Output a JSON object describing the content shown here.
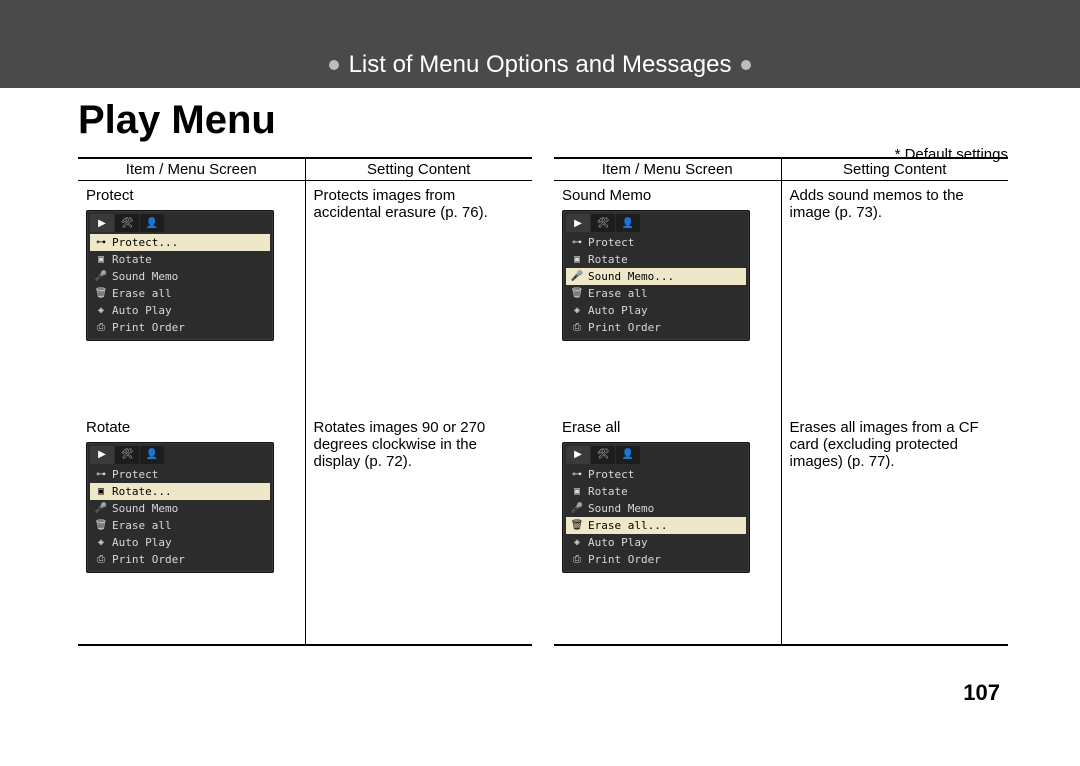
{
  "chapter_title": "List of Menu Options and Messages",
  "page_heading": "Play Menu",
  "default_note": "* Default settings",
  "page_number": "107",
  "lcd_tabs": [
    "▶",
    "🛠",
    "👤"
  ],
  "lcd_items_base": [
    {
      "icon": "⊶",
      "label": "Protect"
    },
    {
      "icon": "▣",
      "label": "Rotate"
    },
    {
      "icon": "🎤",
      "label": "Sound Memo"
    },
    {
      "icon": "🗑",
      "label": "Erase all"
    },
    {
      "icon": "◈",
      "label": "Auto Play"
    },
    {
      "icon": "⎙",
      "label": "Print Order"
    }
  ],
  "columns": [
    {
      "headers": [
        "Item / Menu Screen",
        "Setting Content"
      ],
      "rows": [
        {
          "item": "Protect",
          "content": "Protects images from accidental erasure (p. 76).",
          "highlight_index": 0,
          "highlight_label": "Protect..."
        },
        {
          "item": "Rotate",
          "content": "Rotates images 90 or 270 degrees clockwise in the display (p. 72).",
          "highlight_index": 1,
          "highlight_label": "Rotate..."
        }
      ]
    },
    {
      "headers": [
        "Item / Menu Screen",
        "Setting Content"
      ],
      "rows": [
        {
          "item": "Sound Memo",
          "content": "Adds sound memos to the image (p. 73).",
          "highlight_index": 2,
          "highlight_label": "Sound Memo..."
        },
        {
          "item": "Erase all",
          "content": "Erases all images from a CF card (excluding protected images) (p. 77).",
          "highlight_index": 3,
          "highlight_label": "Erase all..."
        }
      ]
    }
  ]
}
